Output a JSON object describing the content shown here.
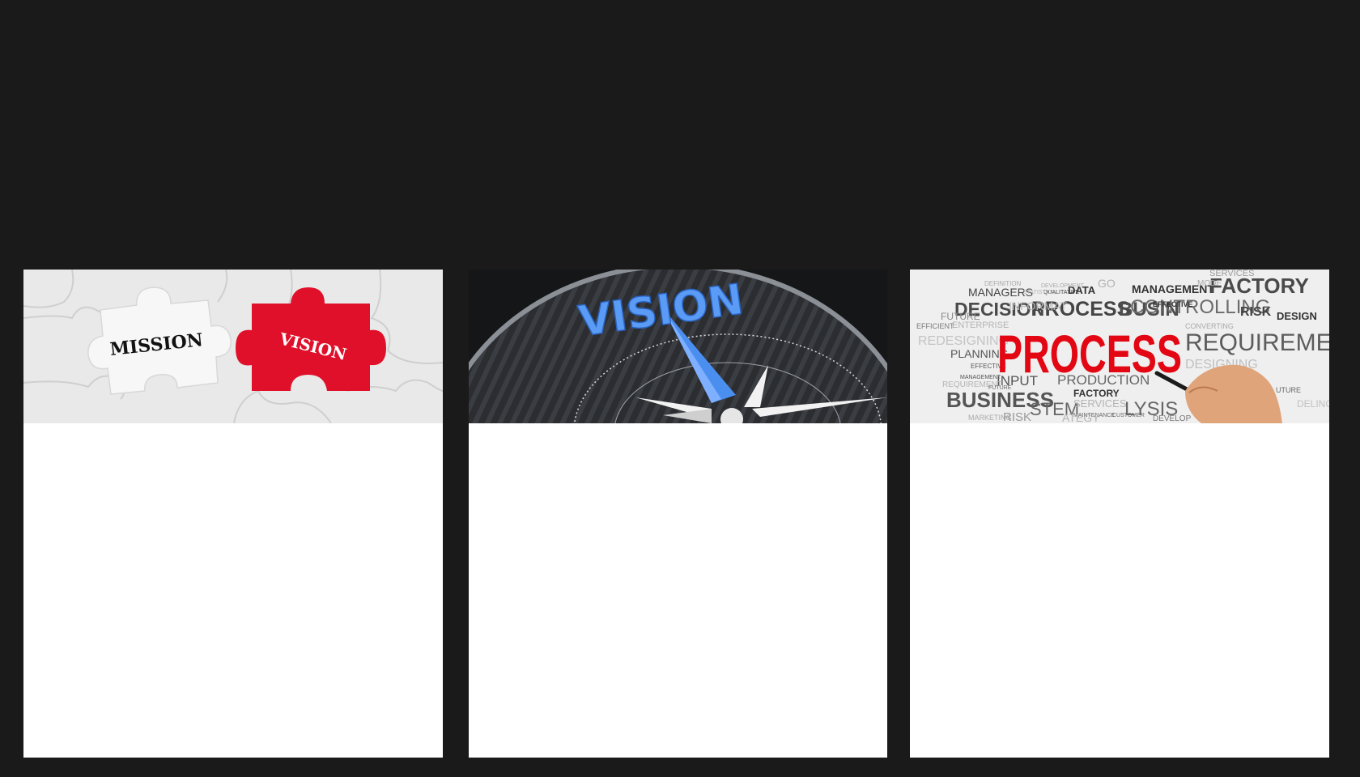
{
  "cards": [
    {
      "image": {
        "subject": "puzzle-pieces",
        "piece_left_text": "MISSION",
        "piece_right_text": "VISION",
        "accent_color": "#e0102a"
      }
    },
    {
      "image": {
        "subject": "compass",
        "heading_text": "VISION",
        "accent_color": "#4a8ff0"
      }
    },
    {
      "image": {
        "subject": "word-cloud",
        "main_word": "PROCESS",
        "accent_color": "#e30613",
        "words_dark": [
          "MANAGERS",
          "DECISION",
          "PROCESS",
          "BUSIN",
          "MANAGEMENT",
          "FACTORY",
          "CONTROLLING",
          "RISK",
          "DESIGN",
          "REQUIREMENT",
          "PLANNING",
          "INPUT",
          "PRODUCTION",
          "BUSINESS",
          "STEM",
          "FACTORY",
          "LYSIS",
          "DATA",
          "EFFECTIVE",
          "QUALITATIVE"
        ],
        "words_light": [
          "DEFINITION",
          "DEVELOPMENT",
          "STATISTICS",
          "SERVICES",
          "FUTURE",
          "INFORMAT",
          "EFFICIENT",
          "ENTERPRISE",
          "REDESIGNING",
          "CONVERTING",
          "DESIGNING",
          "EFFECTIVE",
          "MANAGEMENT",
          "REQUIREMENT",
          "FUTURE",
          "SERVICES",
          "MAINTENANCE",
          "CUSTOMER",
          "MARKETING",
          "RISK",
          "ATEGY",
          "DEVELOP",
          "DELING",
          "UTURE",
          "MODE",
          "GO"
        ]
      }
    }
  ]
}
